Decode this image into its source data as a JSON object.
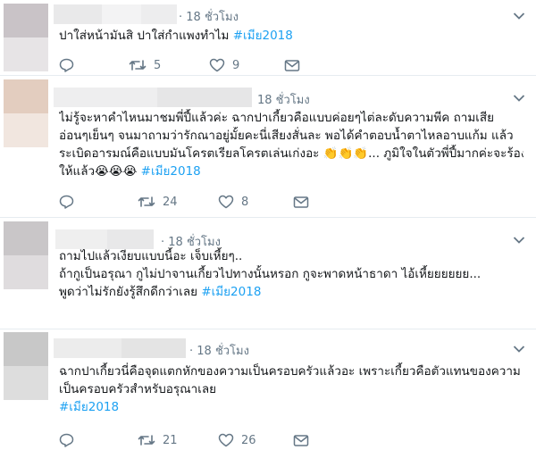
{
  "tweets": [
    {
      "time": "· 18 ชั่วโมง",
      "lines": [
        {
          "text": "ปาใส่หน้ามันสิ ปาใส่กำแพงทำไม ",
          "tag": "#เมีย2018"
        }
      ],
      "reply_count": "",
      "retweet_count": "5",
      "like_count": "9"
    },
    {
      "time": "18 ชั่วโมง",
      "lines": [
        {
          "text": "ไม่รู้จะหาคำไหนมาชมพี่ปี้แล้วค่ะ ฉากปาเกี้ยวคือแบบค่อยๆไต่ละดับความพีค ถามเสีย",
          "tag": ""
        },
        {
          "text": "อ่อนๆเย็นๆ จนมาถามว่ารักณาอยู่มั้ยคะนี่เสียงสั่นละ พอได้คำตอบน้ำตาไหลอาบแก้ม แล้ว",
          "tag": ""
        },
        {
          "text": "ระเบิดอารมณ์คือแบบมันโครตเรียลโครตเล่นเก่งอะ 👏👏👏... ภูมิใจในตัวพี่ปี้มากค่ะจะร้อง",
          "tag": ""
        },
        {
          "text": "ให้แล้ว😭😭😭 ",
          "tag": "#เมีย2018"
        }
      ],
      "reply_count": "",
      "retweet_count": "24",
      "like_count": "8"
    },
    {
      "time": "· 18 ชั่วโมง",
      "lines": [
        {
          "text": "ถามไปแล้วเงียบแบบนี้อะ เจ็บเหี้ยๆ..",
          "tag": ""
        },
        {
          "text": "ถ้ากูเป็นอรุณา กูไม่ปาจานเกี้ยวไปทางนั้นหรอก กูจะพาดหน้าธาดา ไอ้เหี้ยยยยยย...",
          "tag": ""
        },
        {
          "text": "พูดว่าไม่รักยังรู้สึกดีกว่าเลย ",
          "tag": "#เมีย2018"
        }
      ],
      "reply_count": "",
      "retweet_count": "",
      "like_count": ""
    },
    {
      "time": "· 18 ชั่วโมง",
      "lines": [
        {
          "text": "ฉากปาเกี้ยวนี่คือจุดแตกหักของความเป็นครอบครัวแล้วอะ เพราะเกี้ยวคือตัวแทนของความ",
          "tag": ""
        },
        {
          "text": "เป็นครอบครัวสำหรับอรุณาเลย",
          "tag": ""
        },
        {
          "text": "",
          "tag": "#เมีย2018"
        }
      ],
      "reply_count": "",
      "retweet_count": "21",
      "like_count": "26"
    }
  ],
  "icons": {
    "reply": "reply-icon",
    "retweet": "retweet-icon",
    "like": "heart-icon",
    "dm": "envelope-icon",
    "menu": "chevron-down-icon"
  },
  "colors": {
    "hashtag": "#1da1f2",
    "muted": "#657786",
    "divider": "#e6ecf0",
    "text": "#14171a"
  }
}
